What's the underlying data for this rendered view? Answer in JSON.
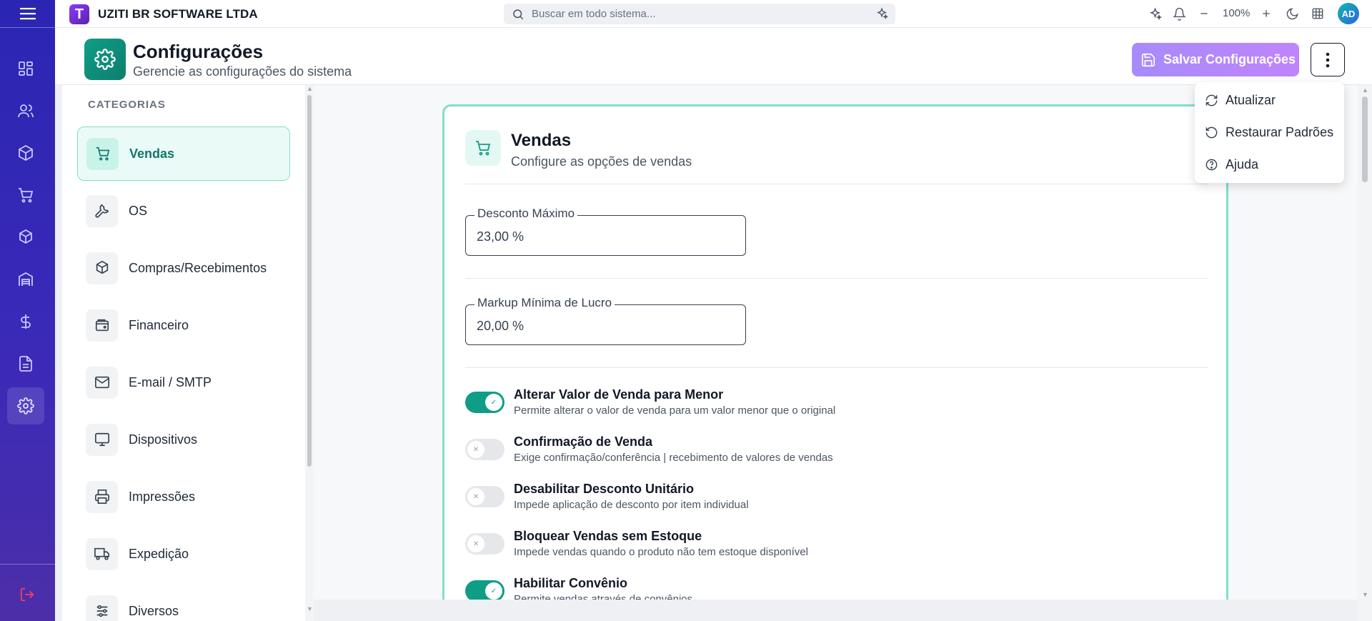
{
  "topbar": {
    "company": "UZITI BR SOFTWARE LTDA",
    "logo_letter": "T",
    "search_placeholder": "Buscar em todo sistema...",
    "zoom": "100%",
    "avatar_initials": "AD"
  },
  "header": {
    "title": "Configurações",
    "subtitle": "Gerencie as configurações do sistema",
    "save_label": "Salvar Configurações"
  },
  "menu": {
    "items": [
      {
        "label": "Atualizar",
        "icon": "refresh-icon"
      },
      {
        "label": "Restaurar Padrões",
        "icon": "restore-icon"
      },
      {
        "label": "Ajuda",
        "icon": "help-icon"
      }
    ]
  },
  "categories": {
    "heading": "CATEGORIAS",
    "items": [
      {
        "label": "Vendas",
        "icon": "cart-icon",
        "active": true
      },
      {
        "label": "OS",
        "icon": "wrench-icon",
        "active": false
      },
      {
        "label": "Compras/Recebimentos",
        "icon": "package-icon",
        "active": false
      },
      {
        "label": "Financeiro",
        "icon": "wallet-icon",
        "active": false
      },
      {
        "label": "E-mail / SMTP",
        "icon": "mail-icon",
        "active": false
      },
      {
        "label": "Dispositivos",
        "icon": "monitor-icon",
        "active": false
      },
      {
        "label": "Impressões",
        "icon": "printer-icon",
        "active": false
      },
      {
        "label": "Expedição",
        "icon": "truck-icon",
        "active": false
      },
      {
        "label": "Diversos",
        "icon": "sliders-icon",
        "active": false
      }
    ]
  },
  "section": {
    "title": "Vendas",
    "subtitle": "Configure as opções de vendas",
    "fields": [
      {
        "label": "Desconto Máximo",
        "value": "23,00 %"
      },
      {
        "label": "Markup Mínima de Lucro",
        "value": "20,00 %"
      }
    ],
    "toggles": [
      {
        "title": "Alterar Valor de Venda para Menor",
        "desc": "Permite alterar o valor de venda para um valor menor que o original",
        "on": true
      },
      {
        "title": "Confirmação de Venda",
        "desc": "Exige confirmação/conferência | recebimento de valores de vendas",
        "on": false
      },
      {
        "title": "Desabilitar Desconto Unitário",
        "desc": "Impede aplicação de desconto por item individual",
        "on": false
      },
      {
        "title": "Bloquear Vendas sem Estoque",
        "desc": "Impede vendas quando o produto não tem estoque disponível",
        "on": false
      },
      {
        "title": "Habilitar Convênio",
        "desc": "Permite vendas através de convênios",
        "on": true
      }
    ]
  },
  "colors": {
    "rail": "#2b25b3",
    "accent": "#0f9d86",
    "card_border": "#7fe0cc",
    "save_button": "#a78bfa"
  }
}
